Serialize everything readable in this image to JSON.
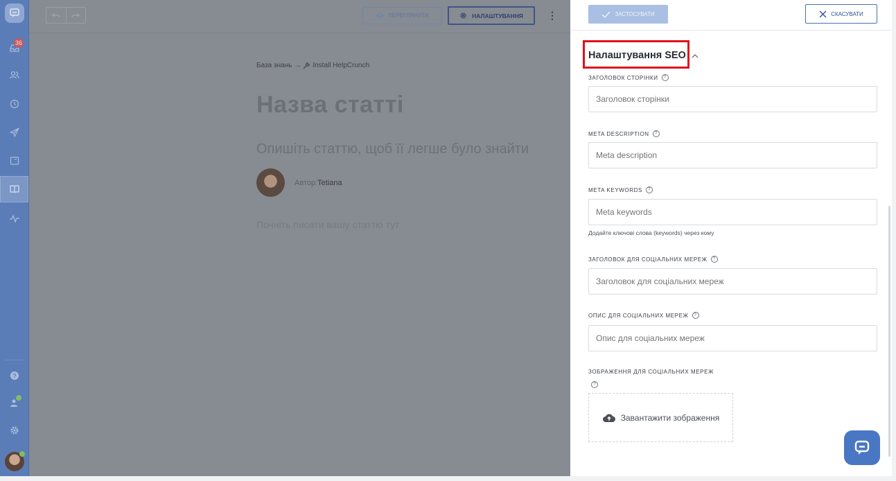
{
  "sidebar": {
    "items": [
      {
        "name": "logo",
        "icon": "chat-bubble-icon"
      },
      {
        "name": "inbox",
        "icon": "inbox-icon",
        "badge": "36"
      },
      {
        "name": "contacts",
        "icon": "users-icon"
      },
      {
        "name": "history",
        "icon": "clock-icon"
      },
      {
        "name": "outbound",
        "icon": "send-icon"
      },
      {
        "name": "popups",
        "icon": "window-icon"
      },
      {
        "name": "knowledge-base",
        "icon": "book-icon",
        "active": true
      },
      {
        "name": "reports",
        "icon": "activity-icon"
      },
      {
        "name": "help",
        "icon": "question-icon"
      },
      {
        "name": "agents",
        "icon": "user-add-icon"
      },
      {
        "name": "settings",
        "icon": "gear-icon"
      },
      {
        "name": "profile",
        "icon": "avatar-icon"
      }
    ]
  },
  "editor": {
    "toolbar": {
      "preview_label": "Переглянути",
      "settings_label": "Налаштування",
      "more_label": "⋮"
    },
    "breadcrumb": {
      "root": "База знань",
      "arrow": "→",
      "section": "Install HelpCrunch"
    },
    "article": {
      "title": "Назва статті",
      "description": "Опишіть статтю, щоб її легше було знайти",
      "author_prefix": "Автор:",
      "author_name": "Tetiana",
      "body_placeholder": "Почніть писати вашу статтю тут"
    }
  },
  "panel": {
    "apply_label": "Застосувати",
    "cancel_label": "Скасувати",
    "section_title": "Налаштування SEO",
    "fields": [
      {
        "label": "Заголовок сторінки",
        "placeholder": "Заголовок сторінки"
      },
      {
        "label": "Meta description",
        "placeholder": "Meta description"
      },
      {
        "label": "Meta keywords",
        "placeholder": "Meta keywords",
        "hint": "Додайте ключові слова (keywords) через кому"
      },
      {
        "label": "Заголовок для соціальних мереж",
        "placeholder": "Заголовок для соціальних мереж"
      },
      {
        "label": "Опис для соціальних мереж",
        "placeholder": "Опис для соціальних мереж"
      }
    ],
    "image_label": "Зображення для соціальних мереж",
    "upload_label": "Завантажити зображення",
    "help_glyph": "?"
  },
  "colors": {
    "sidebar": "#5b7db7",
    "overlay": "#878b92",
    "highlight": "#e0101b",
    "accent": "#4a77c3"
  }
}
